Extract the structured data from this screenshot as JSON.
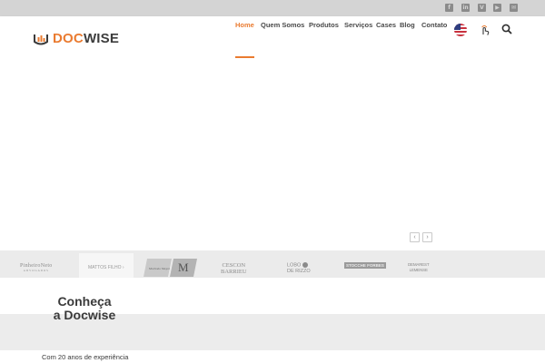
{
  "brand": {
    "logo_doc": "DOC",
    "logo_wise": "WISE",
    "logo_icon": "docwise-logo-icon",
    "accent_color": "#ea7b30"
  },
  "social": [
    {
      "name": "facebook-icon",
      "glyph": "f"
    },
    {
      "name": "linkedin-icon",
      "glyph": "in"
    },
    {
      "name": "vimeo-icon",
      "glyph": "V"
    },
    {
      "name": "youtube-icon",
      "glyph": "▶"
    },
    {
      "name": "email-icon",
      "glyph": "✉"
    }
  ],
  "nav": {
    "items": [
      "Home",
      "Quem Somos",
      "Produtos",
      "Serviços",
      "Cases",
      "Blog",
      "Contato"
    ],
    "active": "Home",
    "language_icon": "us-flag-icon",
    "user_icon": "user-touch-icon",
    "search_icon": "search-icon"
  },
  "hero": {
    "prev": "‹",
    "next": "›"
  },
  "partners": {
    "logos": [
      {
        "name": "pinheiro-neto-logo",
        "text": "PinheiroNeto",
        "sub": "ADVOGADOS"
      },
      {
        "name": "mattos-filho-logo",
        "text": "MATTOS FILHO ›"
      },
      {
        "name": "machado-meyer-logo",
        "text": "Machado Meyer"
      },
      {
        "name": "m-monogram-logo",
        "text": "M"
      },
      {
        "name": "cescon-barrieu-logo",
        "text": "CESCON",
        "text2": "BARRIEU"
      },
      {
        "name": "lobo-de-rizzo-logo",
        "text": "LOBO",
        "text2": "DE RIZZO"
      },
      {
        "name": "stocche-forbes-logo",
        "text": "STOCCHE FORBES"
      },
      {
        "name": "demarest-logo",
        "text": "DEMAREST",
        "text2": "LEMENSE"
      }
    ]
  },
  "about": {
    "title": "Conheça\na Docwise",
    "subtitle": "Com 20 anos de experiência"
  }
}
